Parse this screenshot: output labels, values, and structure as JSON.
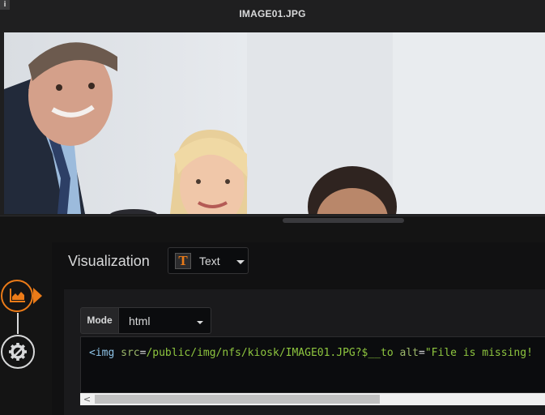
{
  "panel": {
    "info_icon": "info-icon",
    "title": "IMAGE01.JPG",
    "image": "photo-business-team"
  },
  "rail": {
    "visualization_icon": "area-chart-icon",
    "general_icon": "gear-icon",
    "accent": "#eb7b18"
  },
  "editor": {
    "section_label": "Visualization",
    "viz_picker": {
      "icon": "text-panel-icon",
      "icon_glyph": "T",
      "label": "Text"
    },
    "mode": {
      "label": "Mode",
      "value": "html"
    },
    "code": {
      "open_tag": "<img",
      "src_attr": "src",
      "src_value": "/public/img/nfs/kiosk/IMAGE01.JPG?$__to",
      "alt_attr": "alt",
      "alt_value": "\"File is missing!"
    },
    "scrollbar": {
      "left_arrow_glyph": "<"
    }
  },
  "colors": {
    "background": "#141414",
    "panel": "#1f1f20",
    "accent": "#eb7b18",
    "code_string": "#8ec63f",
    "code_tag": "#8ec3e6"
  }
}
